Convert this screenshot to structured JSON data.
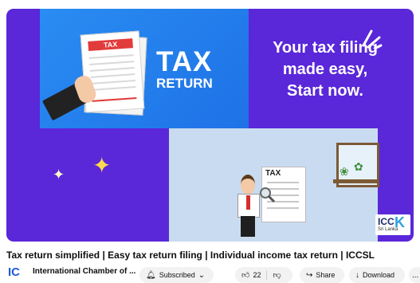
{
  "thumbnail": {
    "tagline": [
      "Your tax filing",
      "made easy,",
      "Start now."
    ],
    "tax_word": "TAX",
    "return_word": "RETURN",
    "doc_header": "TAX",
    "mini_doc_label": "TAX",
    "logo_text": "ICC",
    "logo_letter": "K",
    "logo_sub": "Sri Lanka",
    "colors": {
      "purple": "#5a27d9",
      "blue": "#2a8cf2",
      "light": "#c9dbf0"
    }
  },
  "video": {
    "title": "Tax return simplified | Easy tax return filing | Individual income tax return | ICCSL"
  },
  "channel": {
    "avatar_text": "IC",
    "name": "International Chamber of ..."
  },
  "actions": {
    "subscribe_label": "Subscribed",
    "like_count": "22",
    "share_label": "Share",
    "download_label": "Download",
    "more_label": "..."
  },
  "icons": [
    "bell-icon",
    "chevron-down-icon",
    "thumbs-up-icon",
    "thumbs-down-icon",
    "share-icon",
    "download-icon",
    "more-icon"
  ]
}
